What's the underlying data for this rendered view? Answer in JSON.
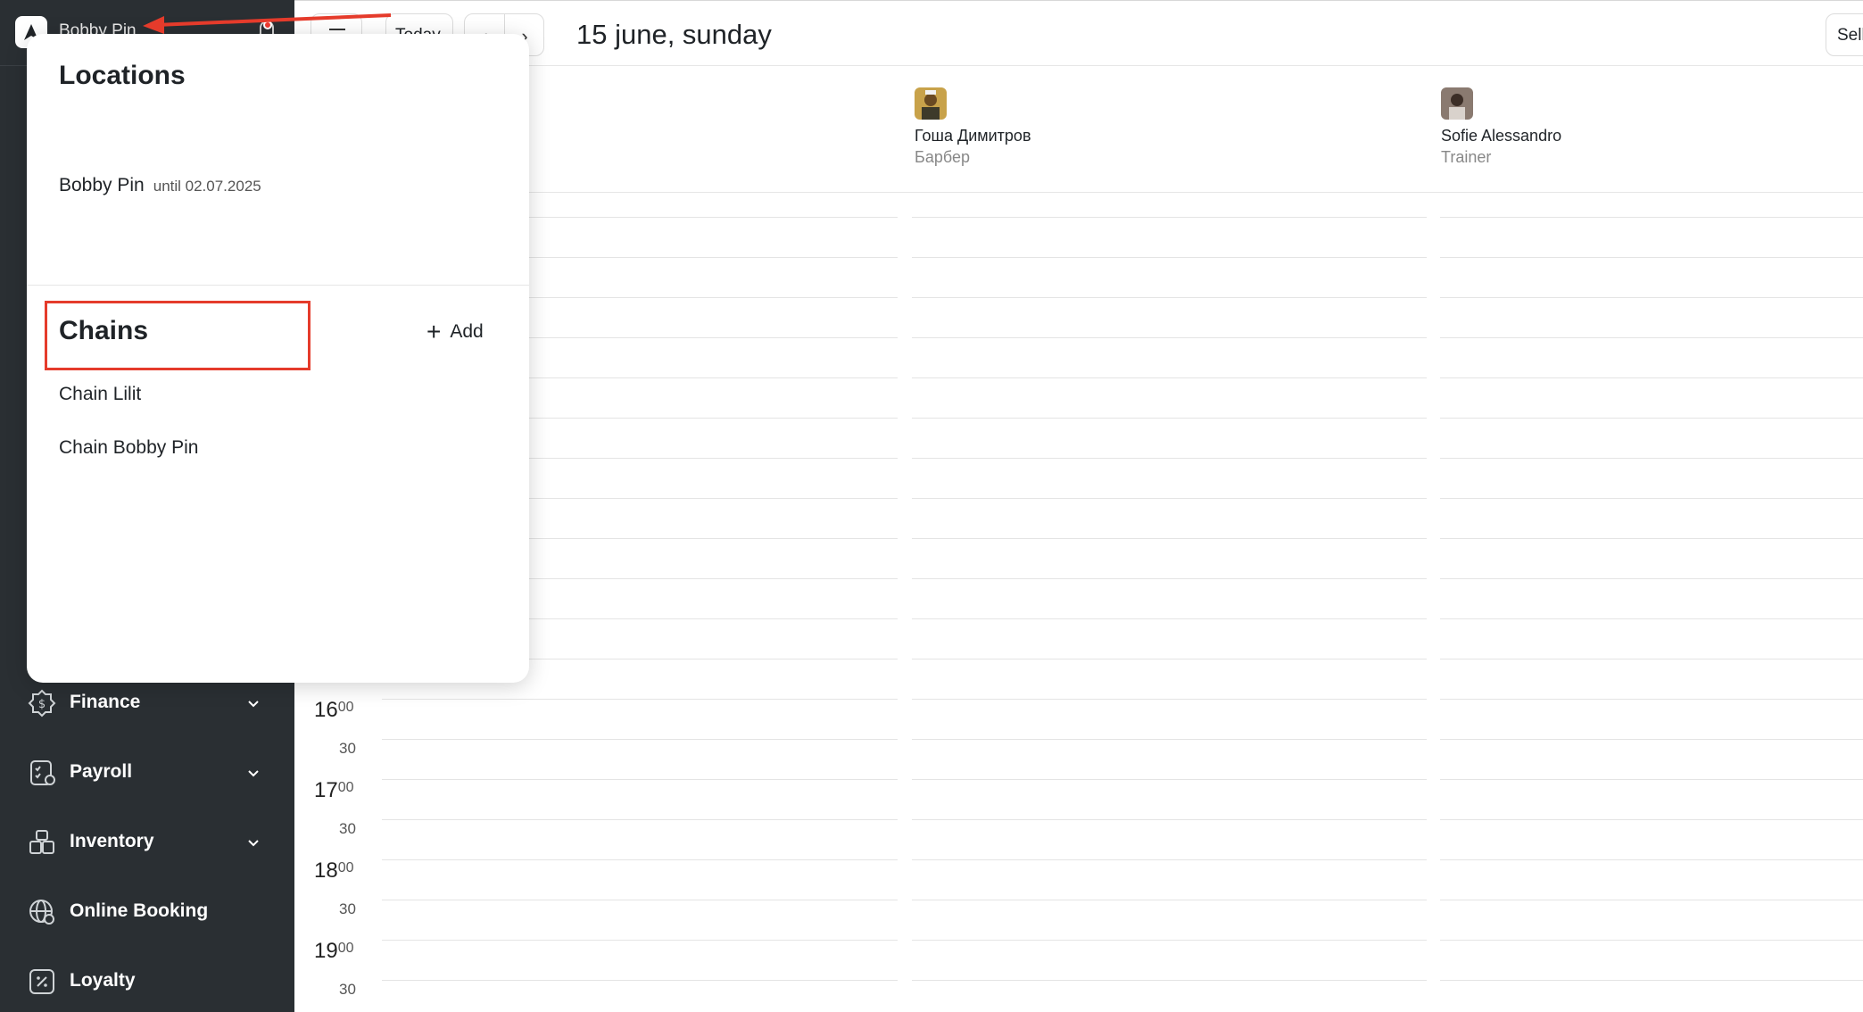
{
  "sidebar": {
    "location_name": "Bobby Pin",
    "menu": [
      {
        "label": "Finance",
        "icon": "finance-icon",
        "expandable": true
      },
      {
        "label": "Payroll",
        "icon": "payroll-icon",
        "expandable": true
      },
      {
        "label": "Inventory",
        "icon": "inventory-icon",
        "expandable": true
      },
      {
        "label": "Online Booking",
        "icon": "online-booking-icon",
        "expandable": false
      },
      {
        "label": "Loyalty",
        "icon": "loyalty-icon",
        "expandable": false
      }
    ]
  },
  "header": {
    "today_label": "Today",
    "prev_label": "‹",
    "next_label": "›",
    "date": "15 june, sunday",
    "sell_label": "Sell"
  },
  "staff": [
    {
      "name": "Гоша Димитров",
      "role": "Барбер",
      "avatar": "avatar-gosha"
    },
    {
      "name": "Sofie Alessandro",
      "role": "Trainer",
      "avatar": "avatar-sofie"
    }
  ],
  "timeline": [
    {
      "hour": "16",
      "min": "00",
      "half": "30"
    },
    {
      "hour": "17",
      "min": "00",
      "half": "30"
    },
    {
      "hour": "18",
      "min": "00",
      "half": "30"
    },
    {
      "hour": "19",
      "min": "00",
      "half": "30"
    }
  ],
  "popover": {
    "locations_title": "Locations",
    "location": {
      "name": "Bobby Pin",
      "until": "until 02.07.2025"
    },
    "chains_title": "Chains",
    "add_label": "Add",
    "chains": [
      "Chain Lilit",
      "Chain Bobby Pin"
    ]
  },
  "colors": {
    "sidebar_bg": "#2a2f33",
    "highlight": "#e53b2b",
    "grid_line": "#e4e4e4"
  }
}
